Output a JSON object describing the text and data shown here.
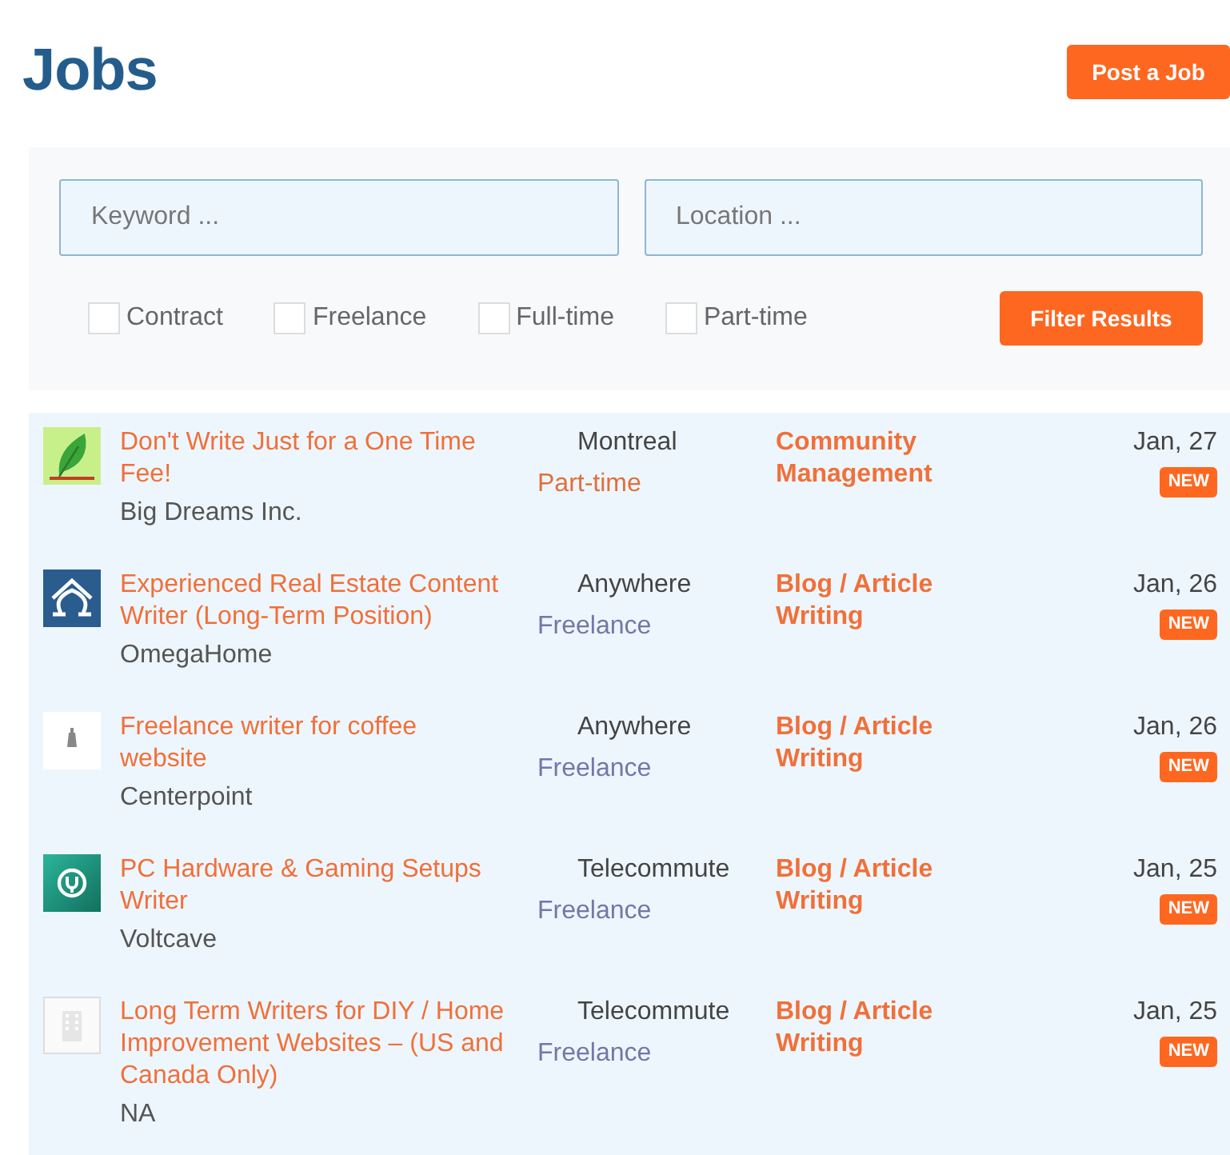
{
  "page_title": "Jobs",
  "post_button": "Post a Job",
  "filters": {
    "keyword": {
      "placeholder": "Keyword ..."
    },
    "location": {
      "placeholder": "Location ..."
    },
    "types": [
      {
        "label": "Contract",
        "checked": false
      },
      {
        "label": "Freelance",
        "checked": false
      },
      {
        "label": "Full-time",
        "checked": false
      },
      {
        "label": "Part-time",
        "checked": false
      }
    ],
    "button": "Filter Results"
  },
  "jobs": [
    {
      "logo": {
        "kind": "leaf"
      },
      "title": "Don't Write Just for a One Time Fee!",
      "company": "Big Dreams Inc.",
      "location": "Montreal",
      "type": {
        "label": "Part-time",
        "color": "#e0703c"
      },
      "category": "Community Management",
      "date": "Jan, 27",
      "badge": "NEW"
    },
    {
      "logo": {
        "kind": "omega"
      },
      "title": "Experienced Real Estate Content Writer (Long-Term Position)",
      "company": "OmegaHome",
      "location": "Anywhere",
      "type": {
        "label": "Freelance",
        "color": "#7377a8"
      },
      "category": "Blog / Article Writing",
      "date": "Jan, 26",
      "badge": "NEW"
    },
    {
      "logo": {
        "kind": "pot"
      },
      "title": "Freelance writer for coffee website",
      "company": "Centerpoint",
      "location": "Anywhere",
      "type": {
        "label": "Freelance",
        "color": "#7377a8"
      },
      "category": "Blog / Article Writing",
      "date": "Jan, 26",
      "badge": "NEW"
    },
    {
      "logo": {
        "kind": "plug"
      },
      "title": "PC Hardware & Gaming Setups Writer",
      "company": "Voltcave",
      "location": "Telecommute",
      "type": {
        "label": "Freelance",
        "color": "#7377a8"
      },
      "category": "Blog / Article Writing",
      "date": "Jan, 25",
      "badge": "NEW"
    },
    {
      "logo": {
        "kind": "building"
      },
      "title": "Long Term Writers for DIY / Home Improvement Websites – (US and Canada Only)",
      "company": "NA",
      "location": "Telecommute",
      "type": {
        "label": "Freelance",
        "color": "#7377a8"
      },
      "category": "Blog / Article Writing",
      "date": "Jan, 25",
      "badge": "NEW"
    }
  ]
}
